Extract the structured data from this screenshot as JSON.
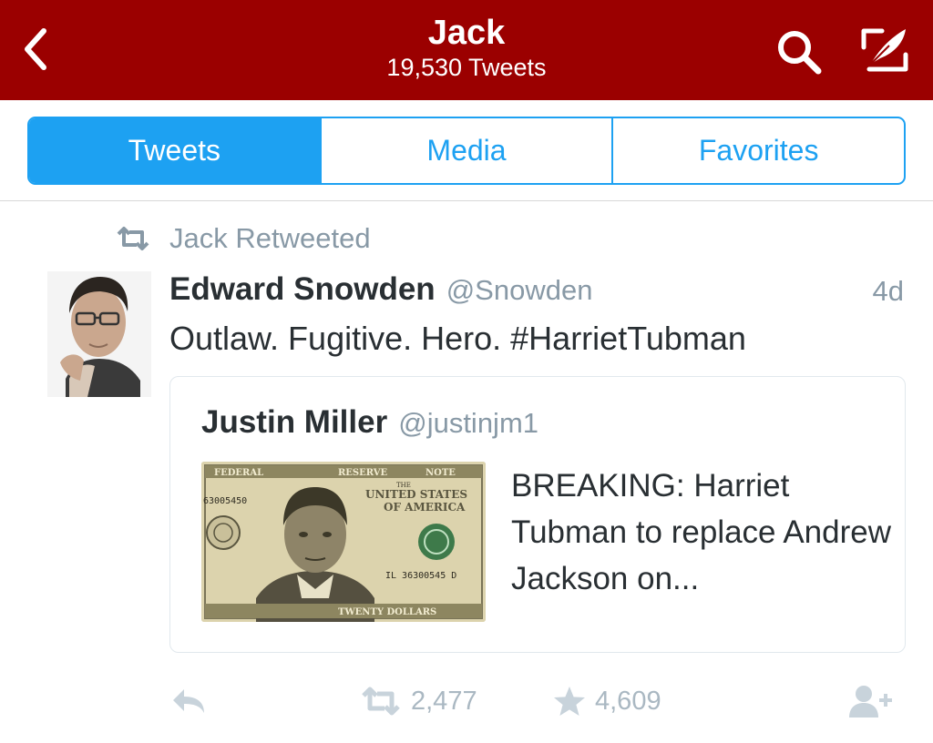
{
  "header": {
    "title": "Jack",
    "subtitle": "19,530 Tweets",
    "background": "#9b0000",
    "back_icon": "chevron-left-icon",
    "search_icon": "search-icon",
    "compose_icon": "compose-icon"
  },
  "tabs": [
    {
      "label": "Tweets",
      "active": true
    },
    {
      "label": "Media",
      "active": false
    },
    {
      "label": "Favorites",
      "active": false
    }
  ],
  "accent": "#1da1f2",
  "tweet": {
    "context": "Jack Retweeted",
    "author_name": "Edward Snowden",
    "author_handle": "@Snowden",
    "time": "4d",
    "text": "Outlaw. Fugitive. Hero. #HarrietTubman",
    "quote": {
      "author_name": "Justin Miller",
      "author_handle": "@justinjm1",
      "text": "BREAKING: Harriet Tubman to replace Andrew Jackson on...",
      "media": {
        "top_left": "FEDERAL",
        "top_mid": "RESERVE",
        "top_right": "NOTE",
        "serial_left": "63005450",
        "title_small": "THE",
        "title_line1": "UNITED STATES",
        "title_line2": "OF AMERICA",
        "serial_right": "IL 36300545 D",
        "bottom": "TWENTY DOLLARS"
      }
    },
    "actions": {
      "retweet_count": "2,477",
      "favorite_count": "4,609"
    }
  }
}
